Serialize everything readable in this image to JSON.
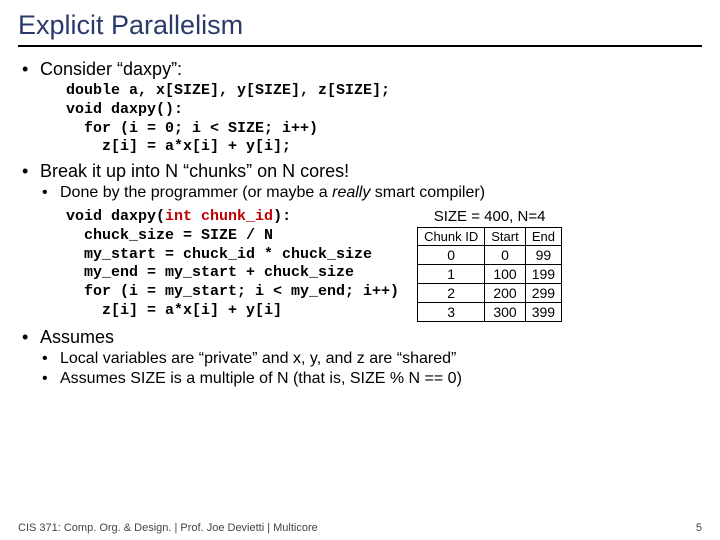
{
  "title": "Explicit Parallelism",
  "b1": {
    "text": "Consider “daxpy”:",
    "code": "double a, x[SIZE], y[SIZE], z[SIZE];\nvoid daxpy():\n  for (i = 0; i < SIZE; i++)\n    z[i] = a*x[i] + y[i];"
  },
  "b2": {
    "text": "Break it up into N “chunks” on N cores!",
    "sub1_a": "Done by the programmer (or maybe a ",
    "sub1_b": "really",
    "sub1_c": " smart compiler)",
    "code_a": "void daxpy(",
    "code_param": "int chunk_id",
    "code_b": "):\n  chuck_size = SIZE / N\n  my_start = chuck_id * chuck_size\n  my_end = my_start + chuck_size\n  for (i = my_start; i < my_end; i++)\n    z[i] = a*x[i] + y[i]",
    "caption": "SIZE = 400, N=4"
  },
  "b3": {
    "text": "Assumes",
    "sub1": "Local variables are “private” and x, y, and z are “shared”",
    "sub2": "Assumes SIZE is a multiple of N (that is, SIZE % N == 0)"
  },
  "footer_left": "CIS 371: Comp. Org. & Design. |  Prof. Joe Devietti  |  Multicore",
  "footer_right": "5",
  "chart_data": {
    "type": "table",
    "title": "SIZE = 400, N=4",
    "columns": [
      "Chunk ID",
      "Start",
      "End"
    ],
    "rows": [
      [
        "0",
        "0",
        "99"
      ],
      [
        "1",
        "100",
        "199"
      ],
      [
        "2",
        "200",
        "299"
      ],
      [
        "3",
        "300",
        "399"
      ]
    ]
  }
}
